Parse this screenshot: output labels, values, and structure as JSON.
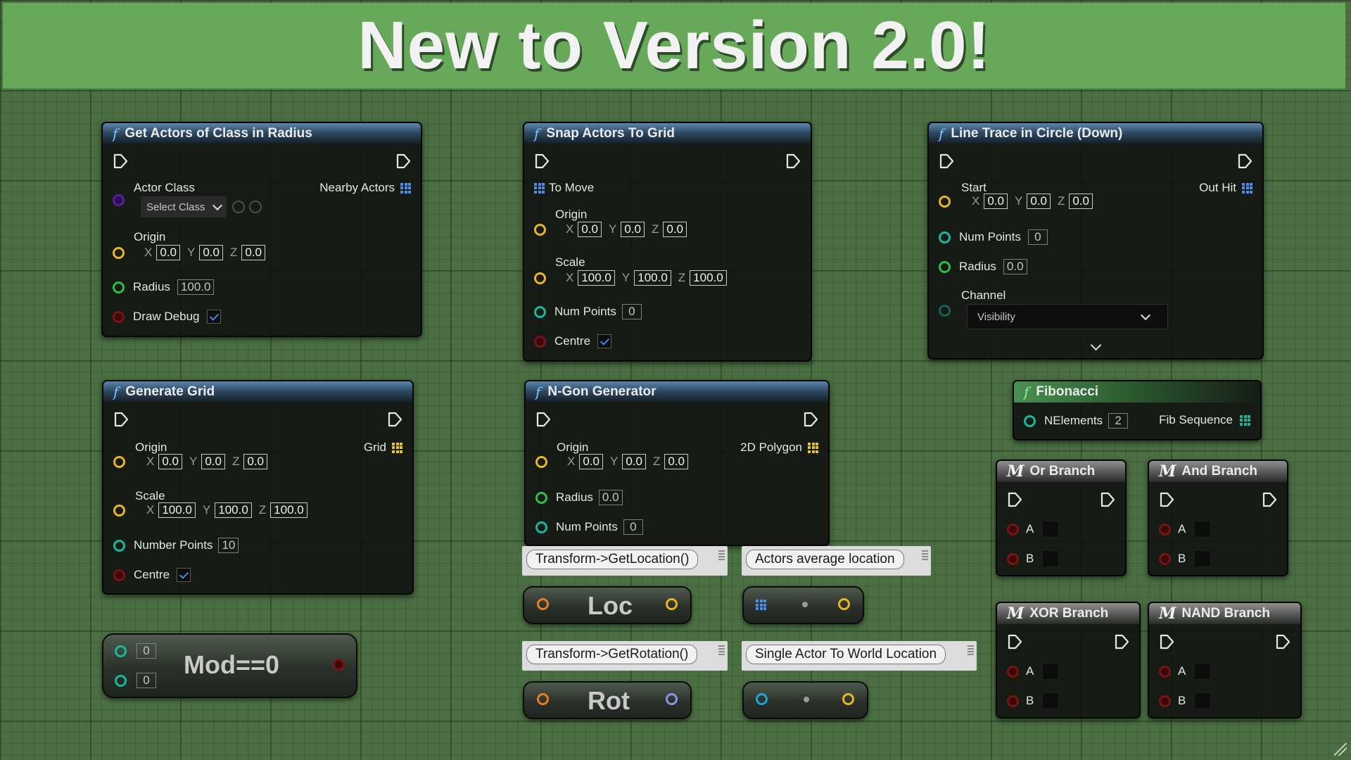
{
  "banner": {
    "title": "New to Version 2.0!"
  },
  "nodes": {
    "get_actors": {
      "title": "Get Actors of Class in Radius",
      "actor_class": "Actor Class",
      "select_class": "Select Class",
      "nearby_actors": "Nearby Actors",
      "origin": "Origin",
      "origin_x": "0.0",
      "origin_y": "0.0",
      "origin_z": "0.0",
      "radius": "Radius",
      "radius_value": "100.0",
      "draw_debug": "Draw Debug"
    },
    "snap_actors": {
      "title": "Snap Actors To Grid",
      "to_move": "To Move",
      "origin": "Origin",
      "origin_x": "0.0",
      "origin_y": "0.0",
      "origin_z": "0.0",
      "scale": "Scale",
      "scale_x": "100.0",
      "scale_y": "100.0",
      "scale_z": "100.0",
      "num_points": "Num Points",
      "num_points_value": "0",
      "centre": "Centre"
    },
    "line_trace": {
      "title": "Line Trace in Circle (Down)",
      "start": "Start",
      "start_x": "0.0",
      "start_y": "0.0",
      "start_z": "0.0",
      "out_hit": "Out Hit",
      "num_points": "Num Points",
      "num_points_value": "0",
      "radius": "Radius",
      "radius_value": "0.0",
      "channel": "Channel",
      "channel_value": "Visibility"
    },
    "generate_grid": {
      "title": "Generate Grid",
      "origin": "Origin",
      "origin_x": "0.0",
      "origin_y": "0.0",
      "origin_z": "0.0",
      "grid": "Grid",
      "scale": "Scale",
      "scale_x": "100.0",
      "scale_y": "100.0",
      "scale_z": "100.0",
      "number_points": "Number Points",
      "number_points_value": "10",
      "centre": "Centre"
    },
    "ngon": {
      "title": "N-Gon Generator",
      "origin": "Origin",
      "origin_x": "0.0",
      "origin_y": "0.0",
      "origin_z": "0.0",
      "polygon": "2D Polygon",
      "radius": "Radius",
      "radius_value": "0.0",
      "num_points": "Num Points",
      "num_points_value": "0"
    },
    "fibonacci": {
      "title": "Fibonacci",
      "nelements": "NElements",
      "nelements_value": "2",
      "fib_sequence": "Fib Sequence"
    },
    "or_branch": {
      "title": "Or Branch",
      "a": "A",
      "b": "B"
    },
    "and_branch": {
      "title": "And Branch",
      "a": "A",
      "b": "B"
    },
    "xor_branch": {
      "title": "XOR Branch",
      "a": "A",
      "b": "B"
    },
    "nand_branch": {
      "title": "NAND Branch",
      "a": "A",
      "b": "B"
    },
    "mod": {
      "label": "Mod==0",
      "a_value": "0",
      "b_value": "0"
    },
    "loc": {
      "label": "Loc",
      "comment": "Transform->GetLocation()"
    },
    "rot": {
      "label": "Rot",
      "comment": "Transform->GetRotation()"
    },
    "avg": {
      "comment": "Actors average location"
    },
    "single": {
      "comment": "Single Actor To World Location"
    }
  },
  "colors": {
    "banner": "#67a85b",
    "graph_background": "#4b6e43",
    "function_header": "#3c6488",
    "pin_vector": "#e8b623",
    "pin_float": "#2fbf4c",
    "pin_int": "#19b89c",
    "pin_bool": "#7a1414",
    "pin_class": "#5a1f9c",
    "pin_array": "#4d8ff0",
    "checkbox": "#3b8bf0"
  },
  "icons": [
    "function-icon",
    "macro-icon",
    "exec-pin-icon",
    "array-grid-icon",
    "checkmark-icon",
    "chevron-down-icon",
    "browse-icon",
    "search-icon",
    "comment-pin-icon",
    "resize-grip-icon"
  ]
}
